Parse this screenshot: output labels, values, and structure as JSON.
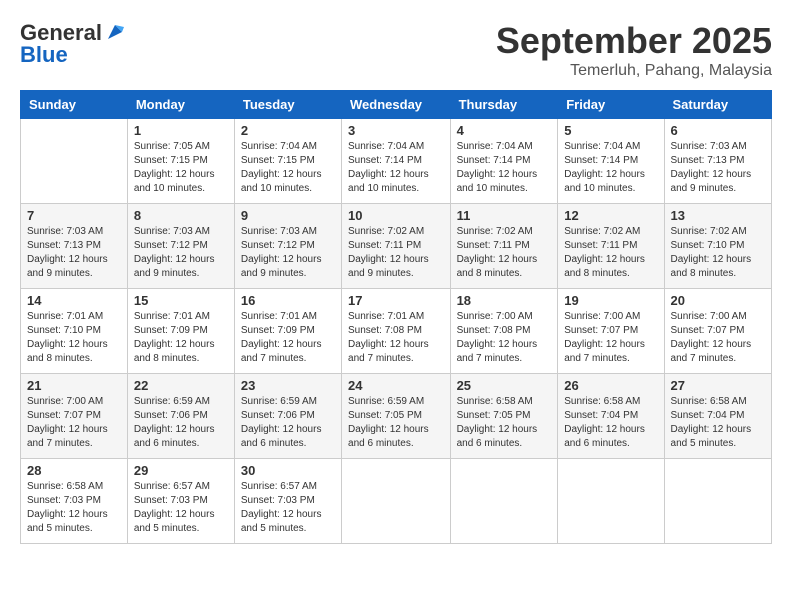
{
  "logo": {
    "general": "General",
    "blue": "Blue"
  },
  "title": {
    "month": "September 2025",
    "location": "Temerluh, Pahang, Malaysia"
  },
  "headers": [
    "Sunday",
    "Monday",
    "Tuesday",
    "Wednesday",
    "Thursday",
    "Friday",
    "Saturday"
  ],
  "weeks": [
    [
      {
        "day": "",
        "info": ""
      },
      {
        "day": "1",
        "info": "Sunrise: 7:05 AM\nSunset: 7:15 PM\nDaylight: 12 hours\nand 10 minutes."
      },
      {
        "day": "2",
        "info": "Sunrise: 7:04 AM\nSunset: 7:15 PM\nDaylight: 12 hours\nand 10 minutes."
      },
      {
        "day": "3",
        "info": "Sunrise: 7:04 AM\nSunset: 7:14 PM\nDaylight: 12 hours\nand 10 minutes."
      },
      {
        "day": "4",
        "info": "Sunrise: 7:04 AM\nSunset: 7:14 PM\nDaylight: 12 hours\nand 10 minutes."
      },
      {
        "day": "5",
        "info": "Sunrise: 7:04 AM\nSunset: 7:14 PM\nDaylight: 12 hours\nand 10 minutes."
      },
      {
        "day": "6",
        "info": "Sunrise: 7:03 AM\nSunset: 7:13 PM\nDaylight: 12 hours\nand 9 minutes."
      }
    ],
    [
      {
        "day": "7",
        "info": "Sunrise: 7:03 AM\nSunset: 7:13 PM\nDaylight: 12 hours\nand 9 minutes."
      },
      {
        "day": "8",
        "info": "Sunrise: 7:03 AM\nSunset: 7:12 PM\nDaylight: 12 hours\nand 9 minutes."
      },
      {
        "day": "9",
        "info": "Sunrise: 7:03 AM\nSunset: 7:12 PM\nDaylight: 12 hours\nand 9 minutes."
      },
      {
        "day": "10",
        "info": "Sunrise: 7:02 AM\nSunset: 7:11 PM\nDaylight: 12 hours\nand 9 minutes."
      },
      {
        "day": "11",
        "info": "Sunrise: 7:02 AM\nSunset: 7:11 PM\nDaylight: 12 hours\nand 8 minutes."
      },
      {
        "day": "12",
        "info": "Sunrise: 7:02 AM\nSunset: 7:11 PM\nDaylight: 12 hours\nand 8 minutes."
      },
      {
        "day": "13",
        "info": "Sunrise: 7:02 AM\nSunset: 7:10 PM\nDaylight: 12 hours\nand 8 minutes."
      }
    ],
    [
      {
        "day": "14",
        "info": "Sunrise: 7:01 AM\nSunset: 7:10 PM\nDaylight: 12 hours\nand 8 minutes."
      },
      {
        "day": "15",
        "info": "Sunrise: 7:01 AM\nSunset: 7:09 PM\nDaylight: 12 hours\nand 8 minutes."
      },
      {
        "day": "16",
        "info": "Sunrise: 7:01 AM\nSunset: 7:09 PM\nDaylight: 12 hours\nand 7 minutes."
      },
      {
        "day": "17",
        "info": "Sunrise: 7:01 AM\nSunset: 7:08 PM\nDaylight: 12 hours\nand 7 minutes."
      },
      {
        "day": "18",
        "info": "Sunrise: 7:00 AM\nSunset: 7:08 PM\nDaylight: 12 hours\nand 7 minutes."
      },
      {
        "day": "19",
        "info": "Sunrise: 7:00 AM\nSunset: 7:07 PM\nDaylight: 12 hours\nand 7 minutes."
      },
      {
        "day": "20",
        "info": "Sunrise: 7:00 AM\nSunset: 7:07 PM\nDaylight: 12 hours\nand 7 minutes."
      }
    ],
    [
      {
        "day": "21",
        "info": "Sunrise: 7:00 AM\nSunset: 7:07 PM\nDaylight: 12 hours\nand 7 minutes."
      },
      {
        "day": "22",
        "info": "Sunrise: 6:59 AM\nSunset: 7:06 PM\nDaylight: 12 hours\nand 6 minutes."
      },
      {
        "day": "23",
        "info": "Sunrise: 6:59 AM\nSunset: 7:06 PM\nDaylight: 12 hours\nand 6 minutes."
      },
      {
        "day": "24",
        "info": "Sunrise: 6:59 AM\nSunset: 7:05 PM\nDaylight: 12 hours\nand 6 minutes."
      },
      {
        "day": "25",
        "info": "Sunrise: 6:58 AM\nSunset: 7:05 PM\nDaylight: 12 hours\nand 6 minutes."
      },
      {
        "day": "26",
        "info": "Sunrise: 6:58 AM\nSunset: 7:04 PM\nDaylight: 12 hours\nand 6 minutes."
      },
      {
        "day": "27",
        "info": "Sunrise: 6:58 AM\nSunset: 7:04 PM\nDaylight: 12 hours\nand 5 minutes."
      }
    ],
    [
      {
        "day": "28",
        "info": "Sunrise: 6:58 AM\nSunset: 7:03 PM\nDaylight: 12 hours\nand 5 minutes."
      },
      {
        "day": "29",
        "info": "Sunrise: 6:57 AM\nSunset: 7:03 PM\nDaylight: 12 hours\nand 5 minutes."
      },
      {
        "day": "30",
        "info": "Sunrise: 6:57 AM\nSunset: 7:03 PM\nDaylight: 12 hours\nand 5 minutes."
      },
      {
        "day": "",
        "info": ""
      },
      {
        "day": "",
        "info": ""
      },
      {
        "day": "",
        "info": ""
      },
      {
        "day": "",
        "info": ""
      }
    ]
  ]
}
